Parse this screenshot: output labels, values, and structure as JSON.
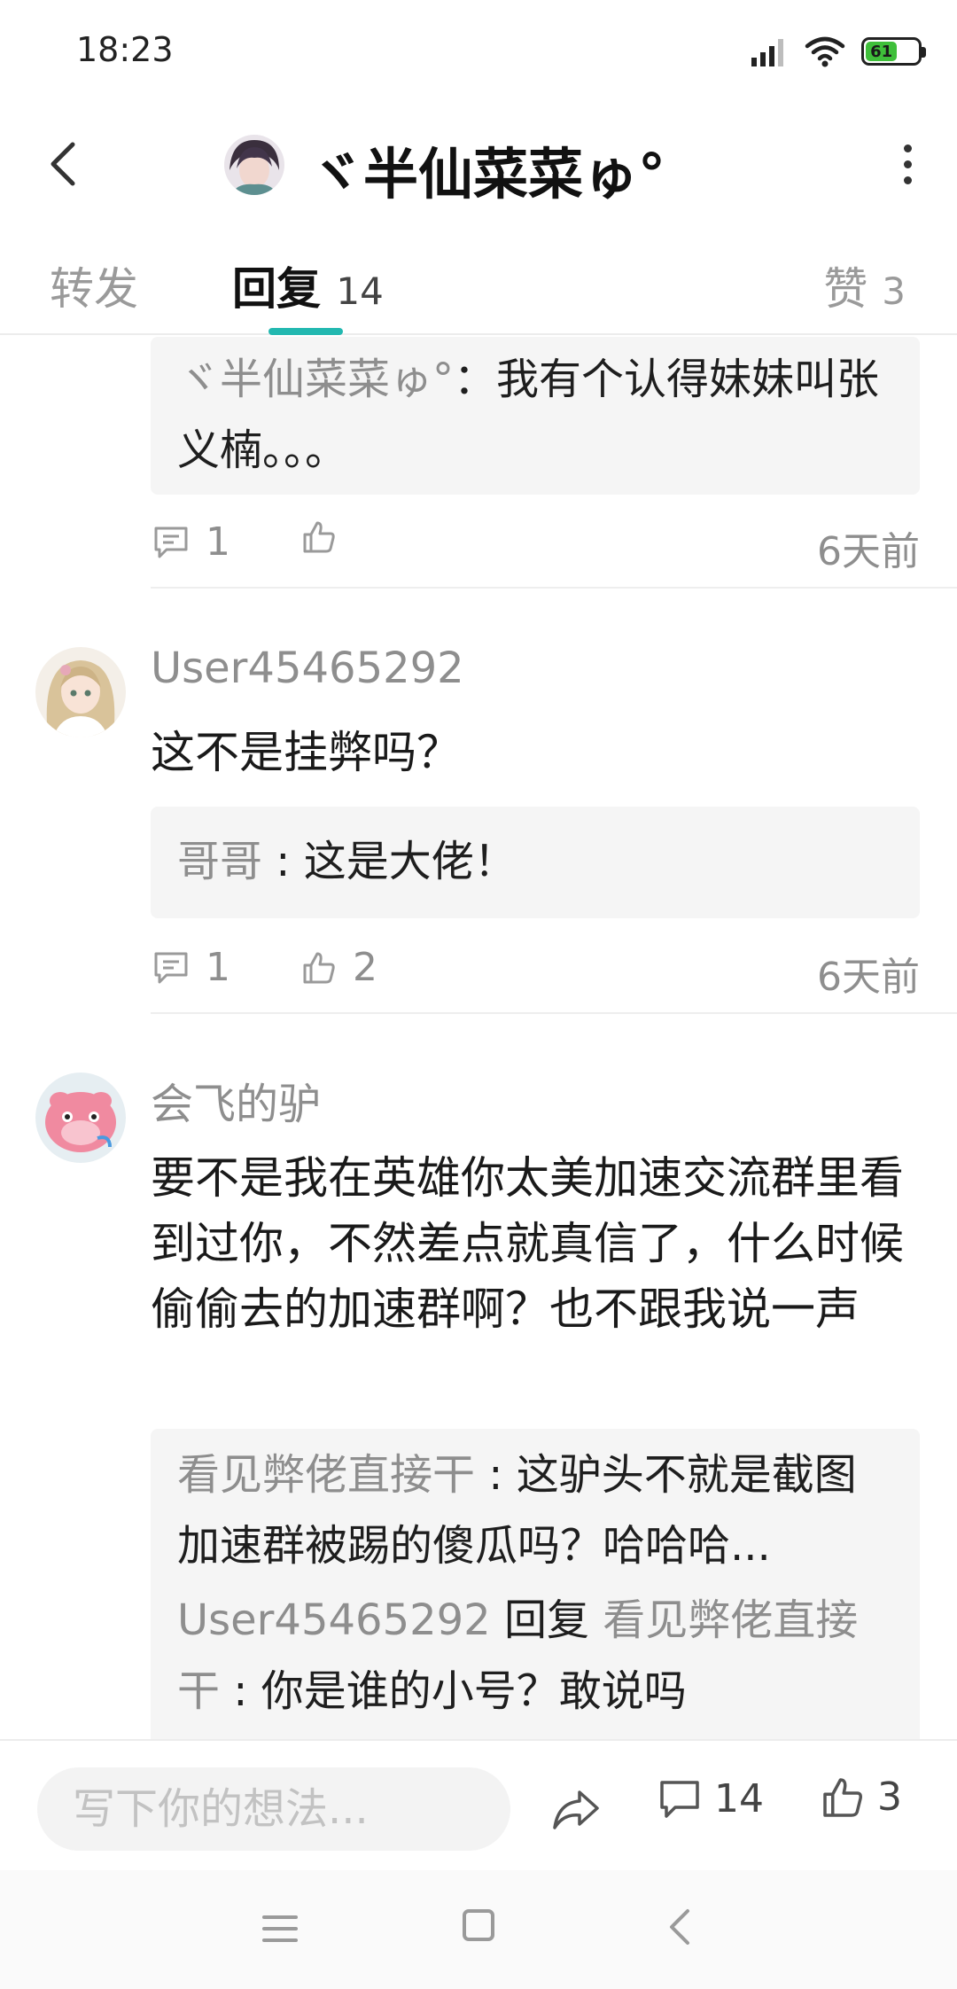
{
  "status_bar": {
    "time": "18:23",
    "battery": "61"
  },
  "header": {
    "title": "ヾ半仙菜菜ゅ°"
  },
  "tabs": {
    "forward": "转发",
    "reply": "回复",
    "reply_count": "14",
    "likes": "赞",
    "likes_count": "3"
  },
  "comments": [
    {
      "quote": {
        "author": "ヾ半仙菜菜ゅ°",
        "separator": "：",
        "text": "我有个认得妹妹叫张义楠。。。"
      },
      "reply_count": "1",
      "like_count": "",
      "time": "6天前"
    },
    {
      "username": "User45465292",
      "text": "这不是挂弊吗？",
      "quote": {
        "author": "哥哥",
        "separator": " : ",
        "text": "这是大佬！"
      },
      "reply_count": "1",
      "like_count": "2",
      "time": "6天前"
    },
    {
      "username": "会飞的驴",
      "text": "要不是我在英雄你太美加速交流群里看到过你，不然差点就真信了，什么时候偷偷去的加速群啊？也不跟我说一声",
      "quotes": [
        {
          "author": "看见弊佬直接干",
          "separator": " : ",
          "text": "这驴头不就是截图加速群被踢的傻瓜吗？哈哈哈..."
        },
        {
          "author": "User45465292",
          "reply_word": " 回复 ",
          "target": "看见弊佬直接干",
          "separator": " : ",
          "text": "你是谁的小号？敢说吗"
        }
      ]
    }
  ],
  "bottom_bar": {
    "input_placeholder": "写下你的想法...",
    "comment_count": "14",
    "like_count": "3"
  },
  "colors": {
    "accent": "#22b8b0",
    "secondary_text": "#8e8e8e",
    "quote_bg": "#f5f5f5"
  }
}
